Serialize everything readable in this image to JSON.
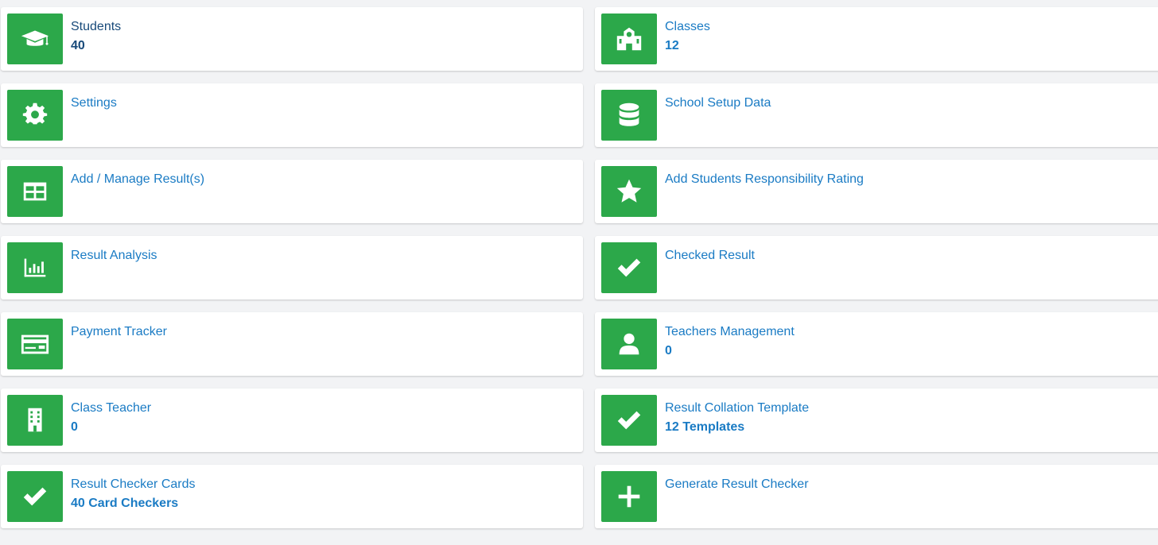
{
  "accent_color": "#2ca84a",
  "link_color": "#1a7bc4",
  "cards": [
    {
      "title": "Students",
      "value": "40",
      "icon": "graduation-cap-icon"
    },
    {
      "title": "Classes",
      "value": "12",
      "icon": "school-building-icon"
    },
    {
      "title": "Settings",
      "value": "",
      "icon": "gear-icon"
    },
    {
      "title": "School Setup Data",
      "value": "",
      "icon": "database-icon"
    },
    {
      "title": "Add / Manage Result(s)",
      "value": "",
      "icon": "table-icon"
    },
    {
      "title": "Add Students Responsibility Rating",
      "value": "",
      "icon": "star-icon"
    },
    {
      "title": "Result Analysis",
      "value": "",
      "icon": "bar-chart-icon"
    },
    {
      "title": "Checked Result",
      "value": "",
      "icon": "checkmark-icon"
    },
    {
      "title": "Payment Tracker",
      "value": "",
      "icon": "credit-card-icon"
    },
    {
      "title": "Teachers Management",
      "value": "0",
      "icon": "user-icon"
    },
    {
      "title": "Class Teacher",
      "value": "0",
      "icon": "office-building-icon"
    },
    {
      "title": "Result Collation Template",
      "value": "12 Templates",
      "icon": "checkmark-icon"
    },
    {
      "title": "Result Checker Cards",
      "value": "40 Card Checkers",
      "icon": "checkmark-icon"
    },
    {
      "title": "Generate Result Checker",
      "value": "",
      "icon": "plus-icon"
    }
  ]
}
